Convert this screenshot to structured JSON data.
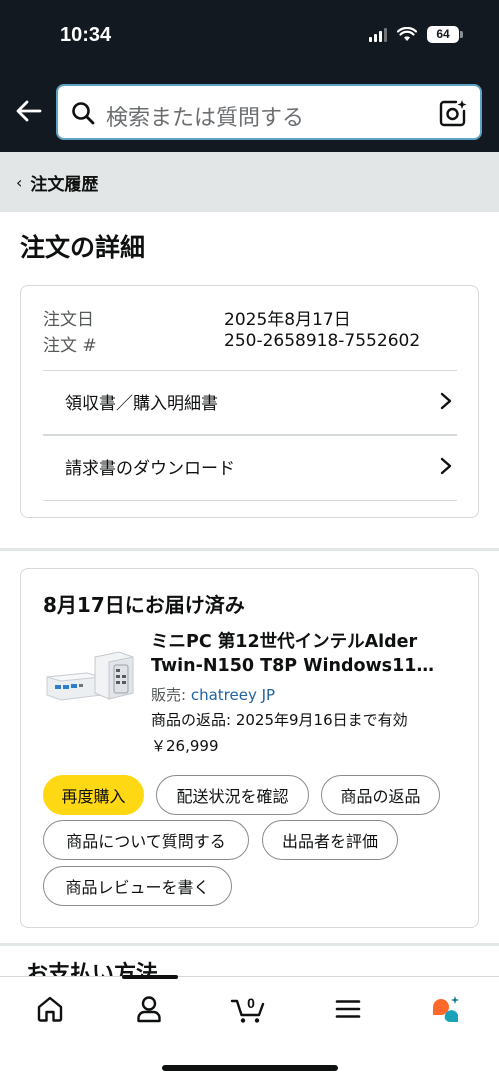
{
  "status_bar": {
    "time": "10:34",
    "battery": "64"
  },
  "header": {
    "search_placeholder": "検索または質問する",
    "icons": [
      "back-arrow-icon",
      "search-icon",
      "camera-lens-icon"
    ]
  },
  "breadcrumb": {
    "label": "注文履歴"
  },
  "page": {
    "title": "注文の詳細"
  },
  "order_info": {
    "date_label": "注文日",
    "date_value": "2025年8月17日",
    "number_label": "注文 #",
    "number_value": "250-2658918-7552602",
    "links": [
      {
        "label": "領収書／購入明細書"
      },
      {
        "label": "請求書のダウンロード"
      }
    ]
  },
  "delivery": {
    "title": "8月17日にお届け済み",
    "product": {
      "name_line1": "ミニPC 第12世代インテルAlder",
      "name_line2": "Twin-N150 T8P Windows11…",
      "seller_label": "販売: ",
      "seller_name": "chatreey JP",
      "return_text": "商品の返品: 2025年9月16日まで有効",
      "price": "￥26,999"
    },
    "actions": [
      {
        "label": "再度購入"
      },
      {
        "label": "配送状況を確認"
      },
      {
        "label": "商品の返品"
      },
      {
        "label": "商品について質問する"
      },
      {
        "label": "出品者を評価"
      },
      {
        "label": "商品レビューを書く"
      }
    ]
  },
  "next_section": {
    "title": "お支払い方法"
  },
  "bottom_nav": {
    "cart_count": "0",
    "items": [
      "home-icon",
      "account-icon",
      "cart-icon",
      "menu-icon",
      "rufus-icon"
    ]
  },
  "colors": {
    "header_bg": "#131921",
    "primary_button": "#ffd814",
    "link": "#2162a1",
    "breadcrumb_bg": "#e3e6e6"
  }
}
